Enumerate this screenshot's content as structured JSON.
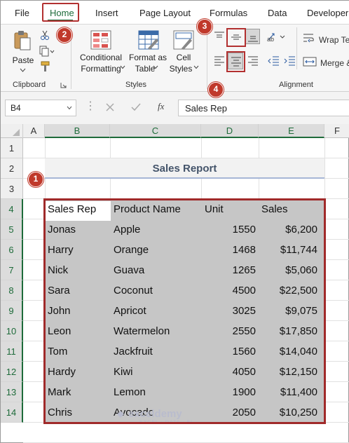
{
  "ribbon_tabs": [
    "File",
    "Home",
    "Insert",
    "Page Layout",
    "Formulas",
    "Data",
    "Developer"
  ],
  "clipboard": {
    "paste_label": "Paste",
    "group_label": "Clipboard"
  },
  "styles": {
    "conditional_formatting_line1": "Conditional",
    "conditional_formatting_line2": "Formatting",
    "format_as_table_line1": "Format as",
    "format_as_table_line2": "Table",
    "cell_styles_line1": "Cell",
    "cell_styles_line2": "Styles",
    "group_label": "Styles"
  },
  "alignment": {
    "wrap_text_label": "Wrap Te",
    "merge_label": "Merge &",
    "group_label": "Alignment"
  },
  "callouts": [
    "1",
    "2",
    "3",
    "4"
  ],
  "formula_bar": {
    "name_box": "B4",
    "fx": "fx",
    "formula": "Sales Rep"
  },
  "columns": [
    "A",
    "B",
    "C",
    "D",
    "E",
    "F"
  ],
  "rows": [
    "1",
    "2",
    "3",
    "4",
    "5",
    "6",
    "7",
    "8",
    "9",
    "10",
    "11",
    "12",
    "13",
    "14"
  ],
  "sheet": {
    "title": "Sales Report",
    "headers": [
      "Sales Rep",
      "Product Name",
      "Unit",
      "Sales"
    ],
    "data": [
      [
        "Jonas",
        "Apple",
        "1550",
        "$6,200"
      ],
      [
        "Harry",
        "Orange",
        "1468",
        "$11,744"
      ],
      [
        "Nick",
        "Guava",
        "1265",
        "$5,060"
      ],
      [
        "Sara",
        "Coconut",
        "4500",
        "$22,500"
      ],
      [
        "John",
        "Apricot",
        "3025",
        "$9,075"
      ],
      [
        "Leon",
        "Watermelon",
        "2550",
        "$17,850"
      ],
      [
        "Tom",
        "Jackfruit",
        "1560",
        "$14,040"
      ],
      [
        "Hardy",
        "Kiwi",
        "4050",
        "$12,150"
      ],
      [
        "Mark",
        "Lemon",
        "1900",
        "$11,400"
      ],
      [
        "Chris",
        "Avocado",
        "2050",
        "$10,250"
      ]
    ]
  },
  "watermark": {
    "name": "exceldemy",
    "tagline": "EXCEL · DATA · BI"
  },
  "colors": {
    "accent_green": "#1e6b3a",
    "callout_red": "#c0392b",
    "title_text": "#44546a",
    "selection_gray": "#c6c6c6"
  }
}
